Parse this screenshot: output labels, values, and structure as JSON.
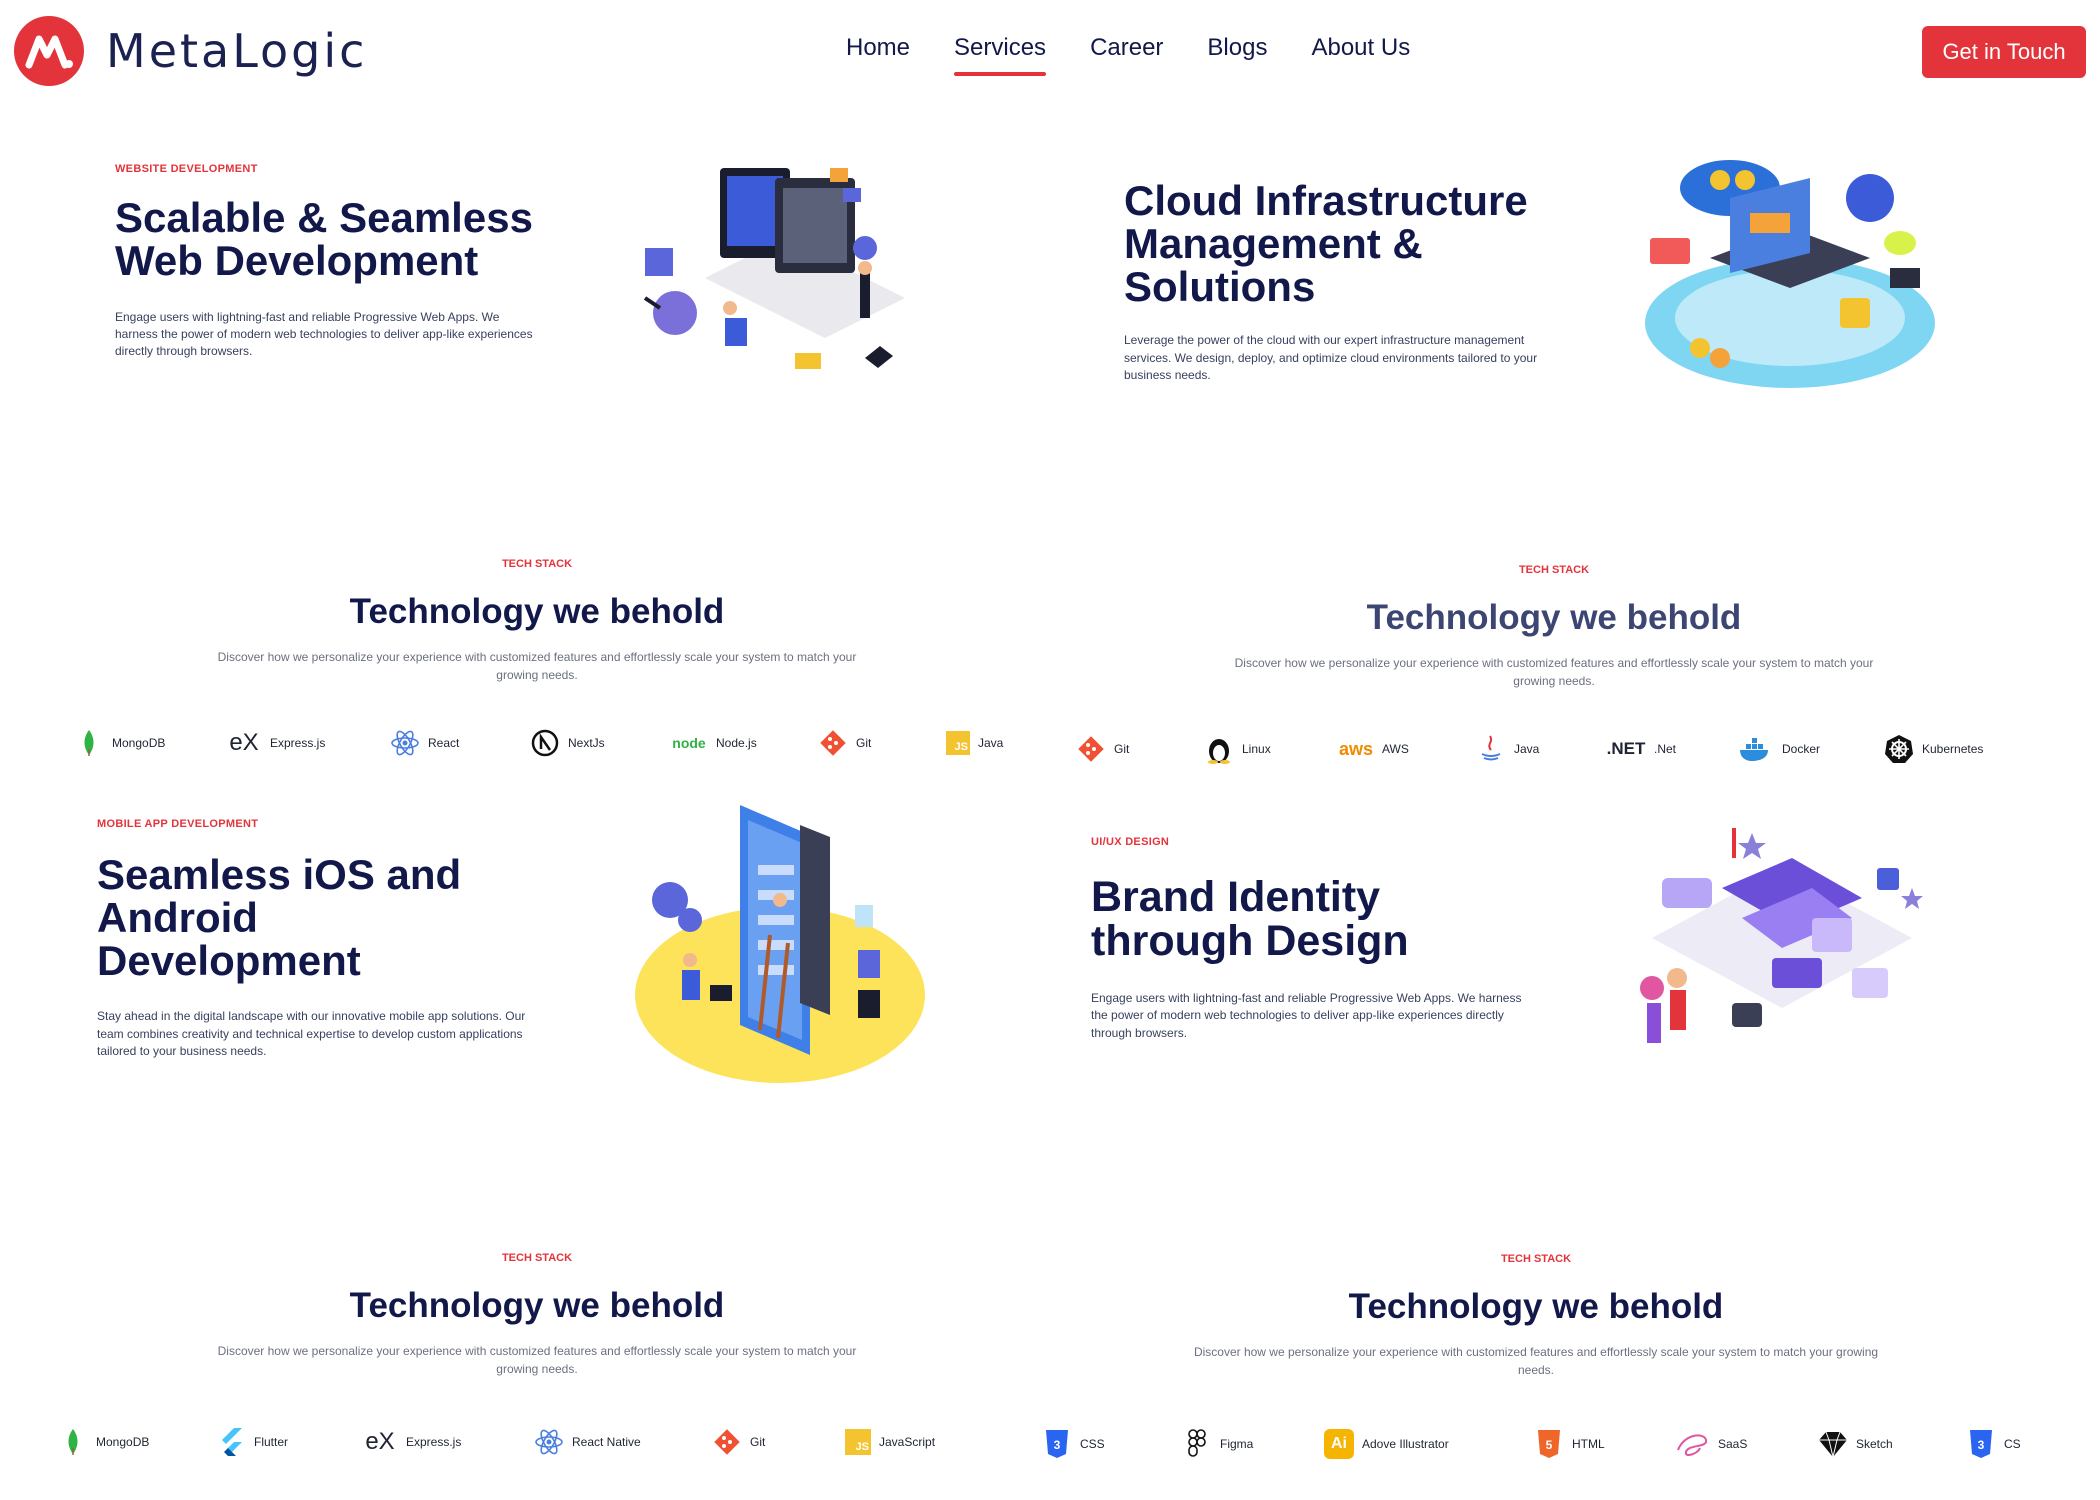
{
  "header": {
    "logo_text": "MetaLogic",
    "logo_mark": "M.",
    "nav": [
      "Home",
      "Services",
      "Career",
      "Blogs",
      "About Us"
    ],
    "active_nav": "Services",
    "cta": "Get in Touch"
  },
  "services": [
    {
      "tag": "WEBSITE DEVELOPMENT",
      "title": "Scalable & Seamless Web Development",
      "desc": "Engage users with lightning-fast and reliable Progressive Web Apps. We harness the power of modern web technologies to deliver app-like experiences directly through browsers."
    },
    {
      "tag": "",
      "title": "Cloud Infrastructure Management & Solutions",
      "desc": "Leverage the power of the cloud with our expert infrastructure management services. We design, deploy, and optimize cloud environments tailored to your business needs."
    },
    {
      "tag": "MOBILE APP DEVELOPMENT",
      "title": "Seamless iOS and Android Development",
      "desc": "Stay ahead in the digital landscape with our innovative mobile app solutions. Our team combines creativity and technical expertise to develop custom applications tailored to your business needs."
    },
    {
      "tag": "UI/UX DESIGN",
      "title": "Brand Identity through Design",
      "desc": "Engage users with lightning-fast and reliable Progressive Web Apps. We harness the power of modern web technologies to deliver app-like experiences directly through browsers."
    }
  ],
  "tech_sections": [
    {
      "tag": "TECH STACK",
      "title": "Technology we behold",
      "desc": "Discover how we personalize your experience with customized features and effortlessly scale your system to match your growing needs.",
      "logos": [
        "MongoDB",
        "Express.js",
        "React",
        "NextJs",
        "Node.js",
        "Git",
        "Java"
      ]
    },
    {
      "tag": "TECH STACK",
      "title": "Technology we behold",
      "desc": "Discover how we personalize your experience with customized features and effortlessly scale your system to match your growing needs.",
      "logos": [
        "Git",
        "Linux",
        "AWS",
        "Java",
        ".Net",
        "Docker",
        "Kubernetes"
      ]
    },
    {
      "tag": "TECH STACK",
      "title": "Technology we behold",
      "desc": "Discover how we personalize your experience with customized features and effortlessly scale your system to match your growing needs.",
      "logos": [
        "MongoDB",
        "Flutter",
        "Express.js",
        "React Native",
        "Git",
        "JavaScript"
      ]
    },
    {
      "tag": "TECH STACK",
      "title": "Technology we behold",
      "desc": "Discover how we personalize your experience with customized features and effortlessly scale your system to match your growing needs.",
      "logos": [
        "CSS",
        "Figma",
        "Adove Illustrator",
        "HTML",
        "SaaS",
        "Sketch",
        "CS"
      ]
    }
  ],
  "logo_glyphs": {
    "ex": "eX",
    "aws": "aws",
    "net": ".NET",
    "node": "node",
    "ai": "Ai",
    "js": "JS"
  },
  "colors": {
    "accent": "#e3343b",
    "navy": "#12194a"
  }
}
